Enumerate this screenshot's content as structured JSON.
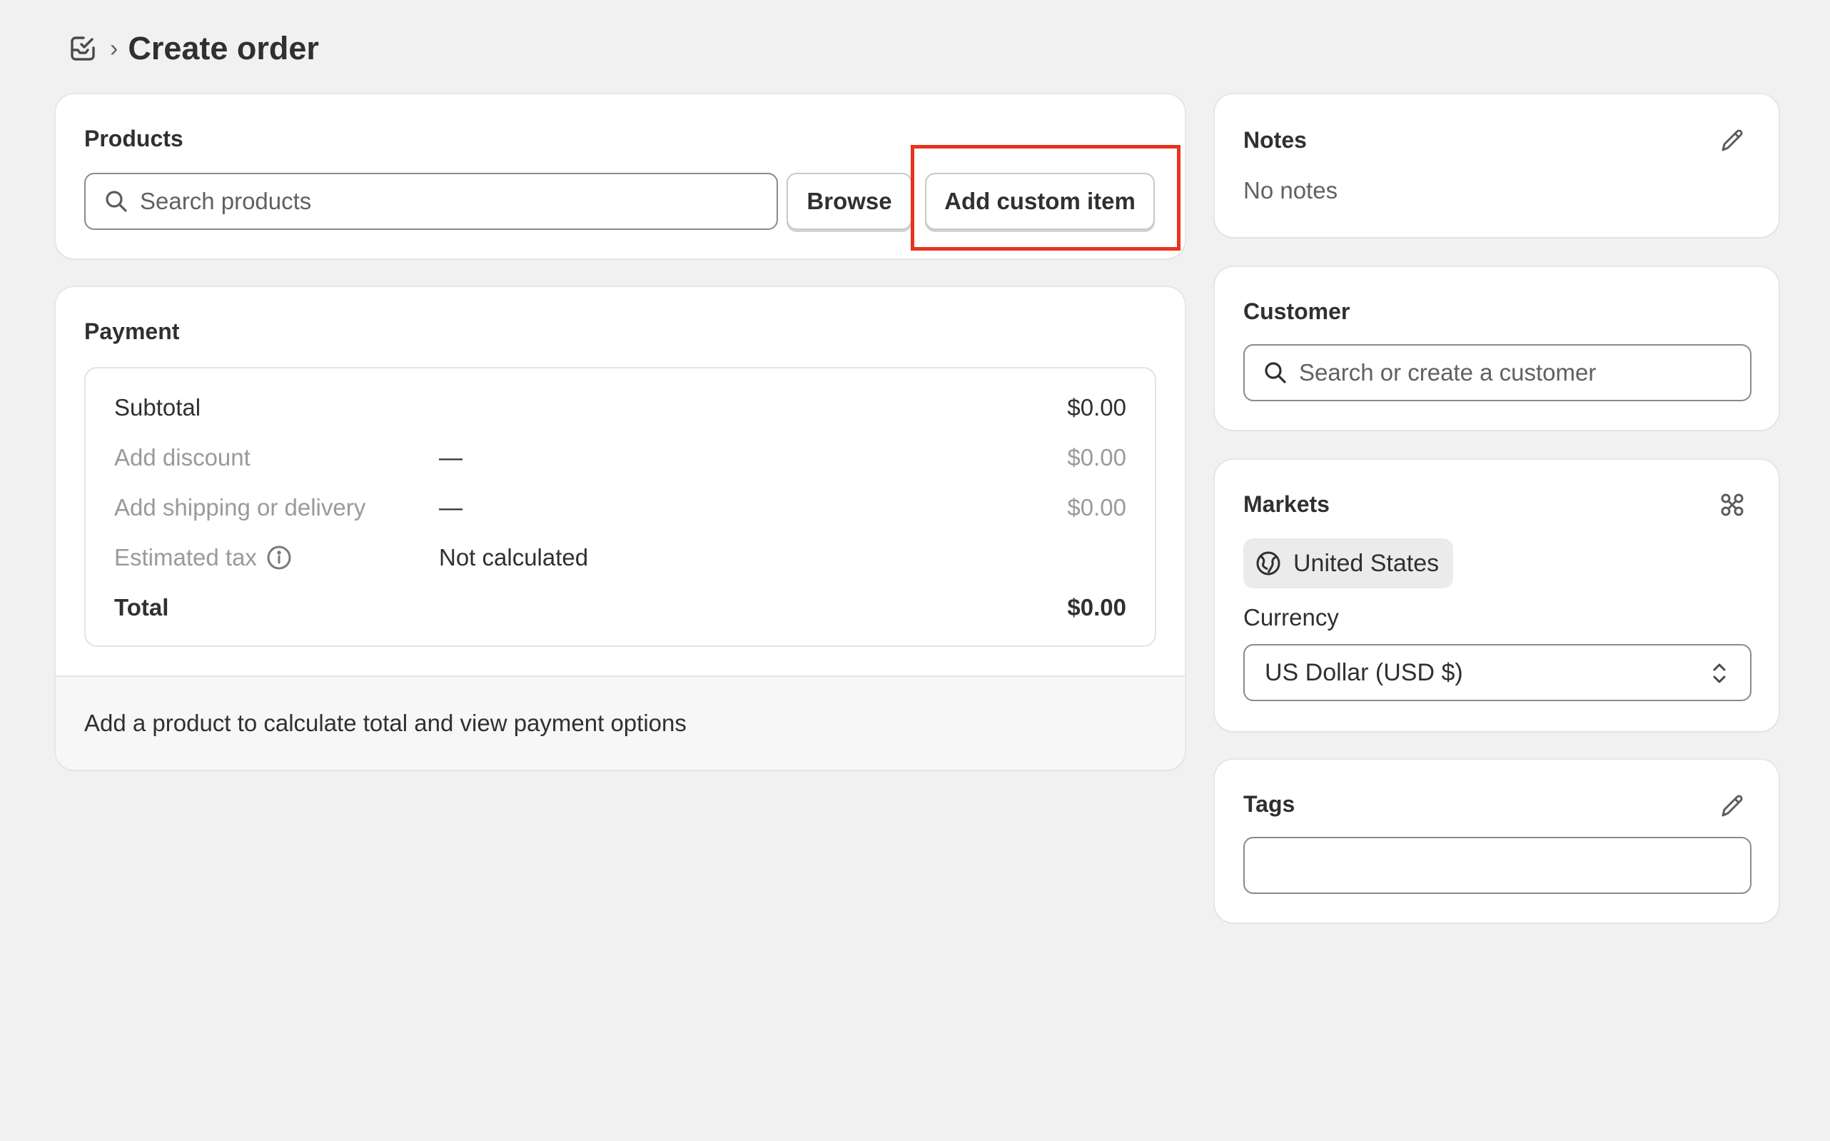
{
  "header": {
    "title": "Create order",
    "breadcrumb_separator": "›",
    "icon": "orders-icon"
  },
  "products": {
    "title": "Products",
    "search_placeholder": "Search products",
    "browse_label": "Browse",
    "add_custom_label": "Add custom item"
  },
  "payment": {
    "title": "Payment",
    "rows": [
      {
        "label": "Subtotal",
        "middle": "",
        "amount": "$0.00"
      },
      {
        "label": "Add discount",
        "middle": "—",
        "amount": "$0.00"
      },
      {
        "label": "Add shipping or delivery",
        "middle": "—",
        "amount": "$0.00"
      },
      {
        "label": "Estimated tax",
        "middle": "Not calculated",
        "amount": ""
      },
      {
        "label": "Total",
        "middle": "",
        "amount": "$0.00"
      }
    ],
    "footer_text": "Add a product to calculate total and view payment options"
  },
  "notes": {
    "title": "Notes",
    "empty_text": "No notes"
  },
  "customer": {
    "title": "Customer",
    "search_placeholder": "Search or create a customer"
  },
  "markets": {
    "title": "Markets",
    "market_name": "United States",
    "currency_label": "Currency",
    "currency_value": "US Dollar (USD $)"
  },
  "tags": {
    "title": "Tags",
    "input_value": ""
  },
  "colors": {
    "highlight": "#e8331d",
    "background": "#f1f1f1",
    "card": "#ffffff"
  }
}
